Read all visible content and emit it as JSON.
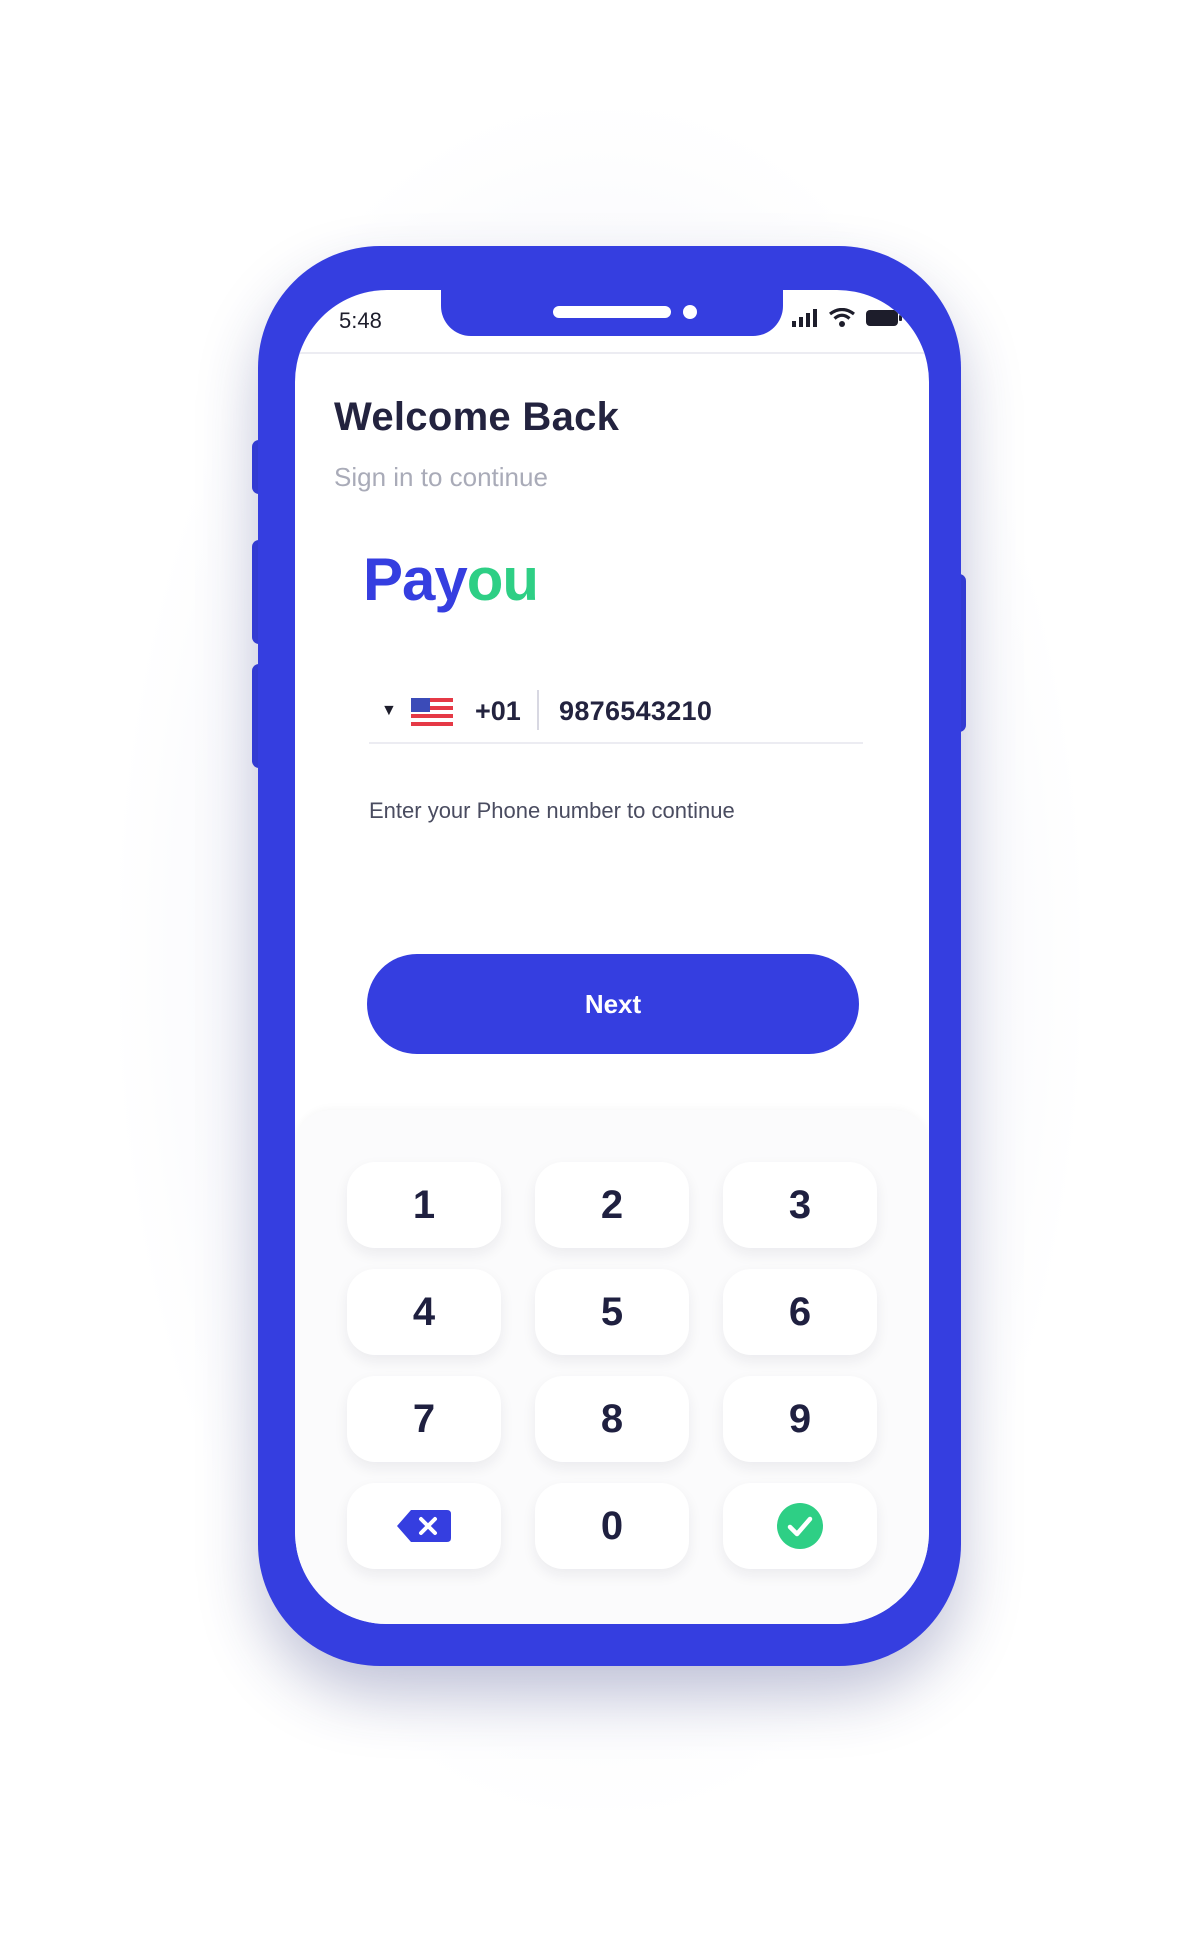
{
  "status_bar": {
    "time": "5:48",
    "icons": [
      "signal-icon",
      "wifi-icon",
      "battery-icon"
    ]
  },
  "header": {
    "title": "Welcome Back",
    "subtitle": "Sign in to continue"
  },
  "logo": {
    "part1": "Pay",
    "part2": "ou"
  },
  "phone_input": {
    "country_flag": "us-flag-icon",
    "country_code": "+01",
    "value": "9876543210"
  },
  "helper_text": "Enter your Phone number to continue",
  "next_button": {
    "label": "Next"
  },
  "keypad": {
    "keys": [
      "1",
      "2",
      "3",
      "4",
      "5",
      "6",
      "7",
      "8",
      "9",
      "",
      "0",
      ""
    ],
    "special": {
      "delete": "backspace-icon",
      "confirm": "check-icon"
    }
  },
  "colors": {
    "primary": "#353ee0",
    "accent": "#2ecf85",
    "text_dark": "#23233f",
    "text_muted": "#a9abb8"
  }
}
